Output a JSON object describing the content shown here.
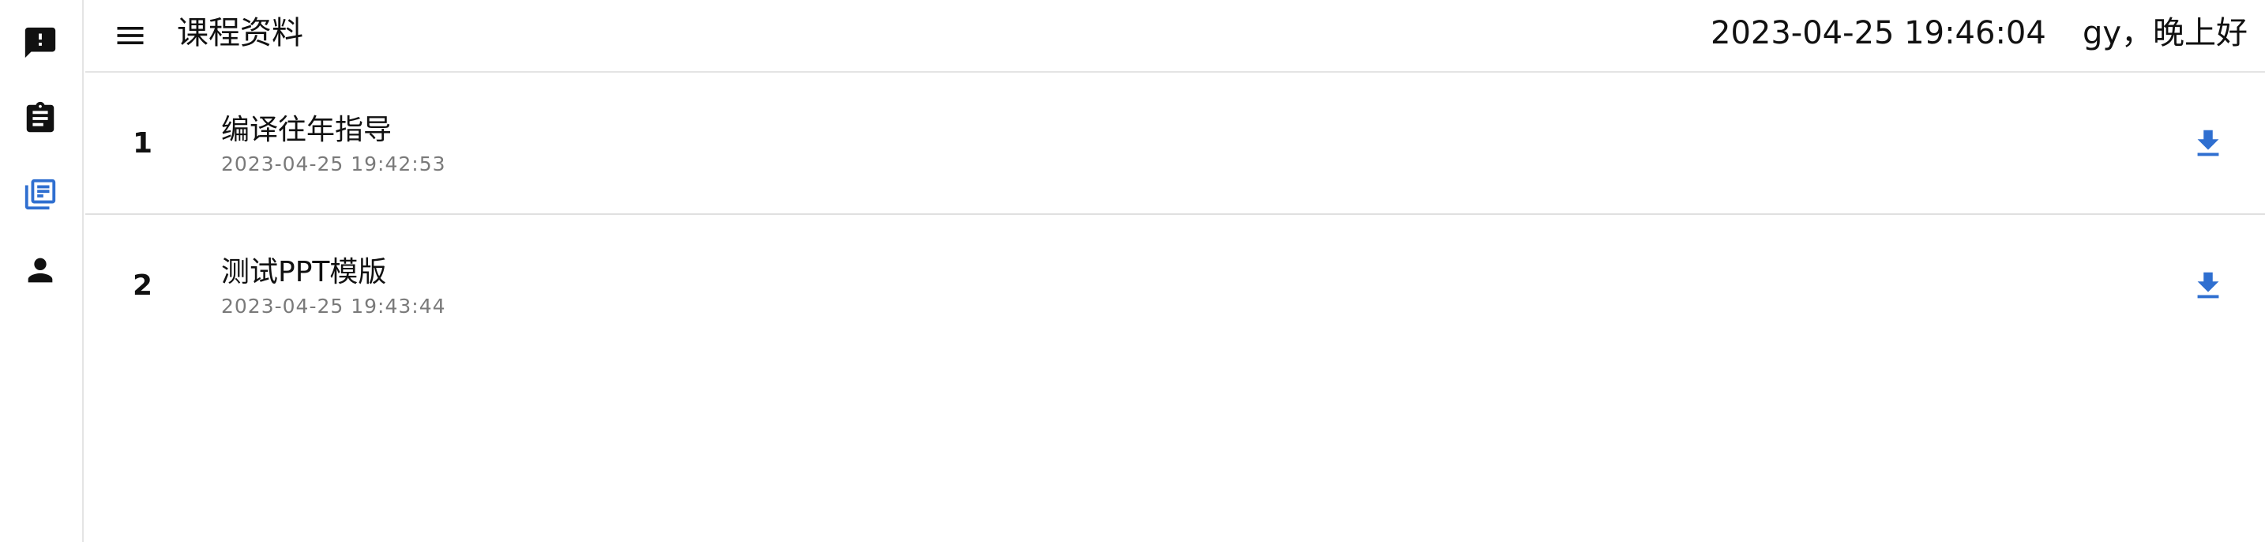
{
  "colors": {
    "accent": "#2f6fd0",
    "icon_default": "#111111",
    "secondary_text": "#7a7a7a",
    "divider": "#e4e4e4"
  },
  "rail": {
    "items": [
      {
        "icon": "feedback-icon",
        "active": false
      },
      {
        "icon": "assignment-icon",
        "active": false
      },
      {
        "icon": "library-books-icon",
        "active": true
      },
      {
        "icon": "person-icon",
        "active": false
      }
    ]
  },
  "header": {
    "menu_icon": "menu-icon",
    "title": "课程资料",
    "clock": "2023-04-25 19:46:04",
    "greeting": "gy，晚上好"
  },
  "materials": [
    {
      "index": "1",
      "title": "编译往年指导",
      "time": "2023-04-25 19:42:53",
      "action_icon": "download-icon"
    },
    {
      "index": "2",
      "title": "测试PPT模版",
      "time": "2023-04-25 19:43:44",
      "action_icon": "download-icon"
    }
  ]
}
